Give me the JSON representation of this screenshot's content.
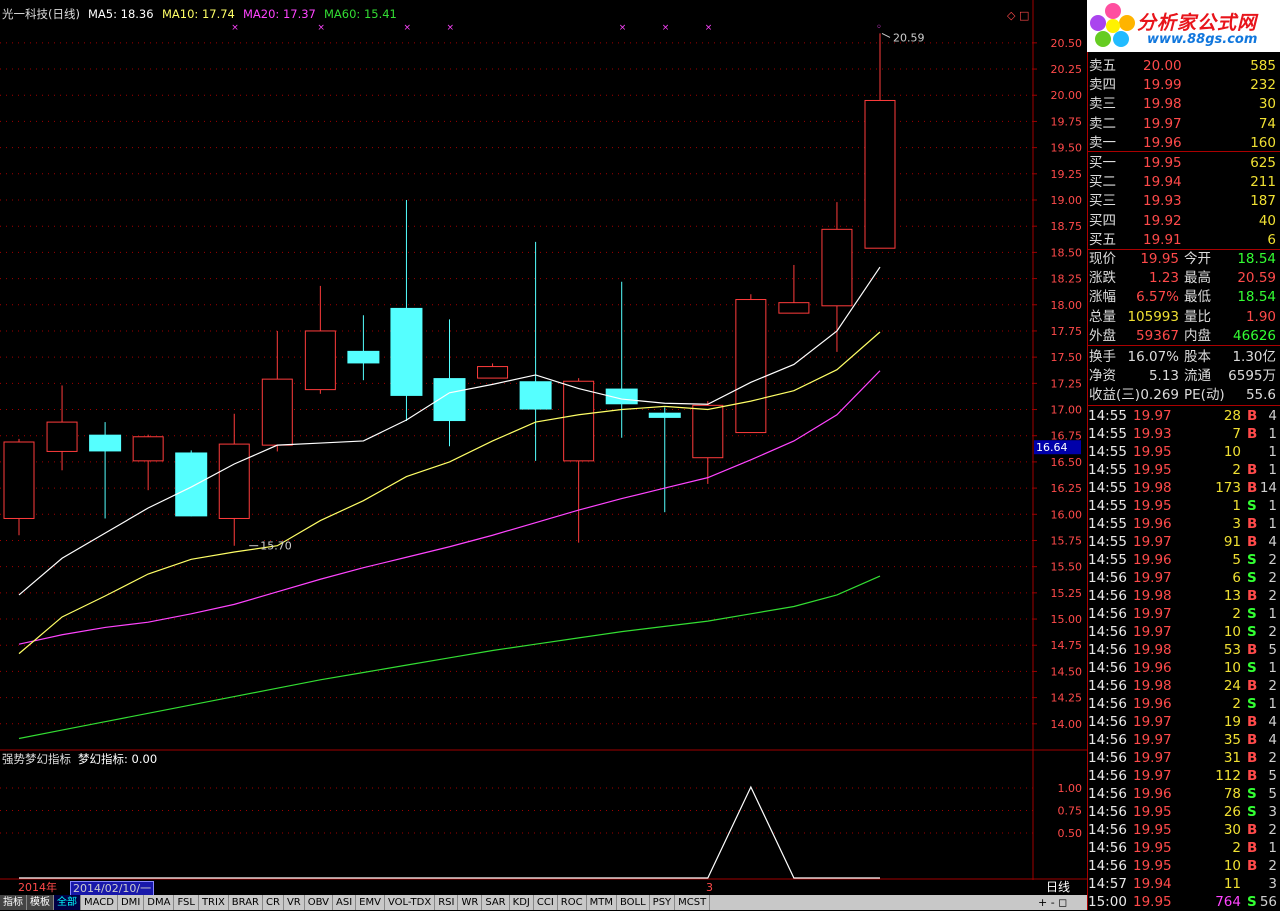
{
  "header": {
    "title": "光一科技(日线)",
    "ma5": "MA5: 18.36",
    "ma10": "MA10: 17.74",
    "ma20": "MA20: 17.37",
    "ma60": "MA60: 15.41"
  },
  "indicator": {
    "title": "强势梦幻指标",
    "value_label": "梦幻指标: 0.00",
    "axis_labels": [
      "1.00",
      "0.75",
      "0.50"
    ]
  },
  "price_axis": [
    "20.50",
    "20.25",
    "20.00",
    "19.75",
    "19.50",
    "19.25",
    "19.00",
    "18.75",
    "18.50",
    "18.25",
    "18.00",
    "17.75",
    "17.50",
    "17.25",
    "17.00",
    "16.75",
    "16.50",
    "16.25",
    "16.00",
    "15.75",
    "15.50",
    "15.25",
    "15.00",
    "14.75",
    "14.50",
    "14.25",
    "14.00"
  ],
  "price_marker": "16.64",
  "annotations": {
    "high": "20.59",
    "low": "15.70"
  },
  "chart_data": {
    "type": "candlestick",
    "ylim": [
      13.75,
      20.68
    ],
    "candles": [
      {
        "o": 15.96,
        "c": 16.69,
        "h": 16.72,
        "l": 15.8
      },
      {
        "o": 16.6,
        "c": 16.88,
        "h": 17.23,
        "l": 16.42
      },
      {
        "o": 16.76,
        "c": 16.6,
        "h": 16.88,
        "l": 15.96
      },
      {
        "o": 16.51,
        "c": 16.74,
        "h": 16.76,
        "l": 16.23
      },
      {
        "o": 16.59,
        "c": 15.98,
        "h": 16.61,
        "l": 15.98
      },
      {
        "o": 15.96,
        "c": 16.67,
        "h": 16.96,
        "l": 15.7
      },
      {
        "o": 16.66,
        "c": 17.29,
        "h": 17.75,
        "l": 16.6
      },
      {
        "o": 17.19,
        "c": 17.75,
        "h": 18.18,
        "l": 17.15
      },
      {
        "o": 17.56,
        "c": 17.44,
        "h": 17.9,
        "l": 17.28
      },
      {
        "o": 17.97,
        "c": 17.13,
        "h": 19.0,
        "l": 16.89
      },
      {
        "o": 17.3,
        "c": 16.89,
        "h": 17.86,
        "l": 16.65
      },
      {
        "o": 17.3,
        "c": 17.41,
        "h": 17.44,
        "l": 17.3
      },
      {
        "o": 17.27,
        "c": 17.0,
        "h": 18.6,
        "l": 16.51
      },
      {
        "o": 16.51,
        "c": 17.27,
        "h": 17.3,
        "l": 15.73
      },
      {
        "o": 17.2,
        "c": 17.05,
        "h": 18.22,
        "l": 16.73
      },
      {
        "o": 16.97,
        "c": 16.92,
        "h": 17.02,
        "l": 16.02
      },
      {
        "o": 16.54,
        "c": 17.04,
        "h": 17.08,
        "l": 16.29
      },
      {
        "o": 16.78,
        "c": 18.05,
        "h": 18.1,
        "l": 16.78
      },
      {
        "o": 17.92,
        "c": 18.02,
        "h": 18.38,
        "l": 17.92
      },
      {
        "o": 17.99,
        "c": 18.72,
        "h": 18.98,
        "l": 17.55
      },
      {
        "o": 18.54,
        "c": 19.95,
        "h": 20.59,
        "l": 18.54
      }
    ],
    "ma5": [
      15.23,
      15.58,
      15.82,
      16.06,
      16.26,
      16.48,
      16.66,
      16.68,
      16.7,
      16.9,
      17.16,
      17.24,
      17.33,
      17.2,
      17.1,
      17.06,
      17.05,
      17.26,
      17.43,
      17.75,
      18.36
    ],
    "ma10": [
      14.67,
      15.02,
      15.22,
      15.43,
      15.57,
      15.64,
      15.7,
      15.94,
      16.13,
      16.36,
      16.5,
      16.7,
      16.88,
      16.95,
      17.0,
      17.03,
      17.0,
      17.08,
      17.18,
      17.38,
      17.74
    ],
    "ma20": [
      14.76,
      14.85,
      14.92,
      14.97,
      15.05,
      15.14,
      15.26,
      15.38,
      15.49,
      15.59,
      15.69,
      15.8,
      15.92,
      16.04,
      16.15,
      16.25,
      16.35,
      16.52,
      16.7,
      16.95,
      17.37
    ],
    "ma60": [
      13.86,
      13.94,
      14.02,
      14.1,
      14.18,
      14.26,
      14.34,
      14.42,
      14.49,
      14.56,
      14.63,
      14.7,
      14.76,
      14.82,
      14.88,
      14.93,
      14.98,
      15.05,
      15.12,
      15.23,
      15.41
    ],
    "indicator": [
      0,
      0,
      0,
      0,
      0,
      0,
      0,
      0,
      0,
      0,
      0,
      0,
      0,
      0,
      0,
      0,
      0,
      1,
      0,
      0,
      0
    ],
    "indicator_ylim": [
      0,
      1.2
    ]
  },
  "orderbook": {
    "asks": [
      {
        "label": "卖五",
        "price": "20.00",
        "vol": "585"
      },
      {
        "label": "卖四",
        "price": "19.99",
        "vol": "232"
      },
      {
        "label": "卖三",
        "price": "19.98",
        "vol": "30"
      },
      {
        "label": "卖二",
        "price": "19.97",
        "vol": "74"
      },
      {
        "label": "卖一",
        "price": "19.96",
        "vol": "160"
      }
    ],
    "bids": [
      {
        "label": "买一",
        "price": "19.95",
        "vol": "625"
      },
      {
        "label": "买二",
        "price": "19.94",
        "vol": "211"
      },
      {
        "label": "买三",
        "price": "19.93",
        "vol": "187"
      },
      {
        "label": "买四",
        "price": "19.92",
        "vol": "40"
      },
      {
        "label": "买五",
        "price": "19.91",
        "vol": "6"
      }
    ]
  },
  "stats": [
    {
      "l1": "现价",
      "v1": "19.95",
      "c1": "#ff4a4a",
      "l2": "今开",
      "v2": "18.54",
      "c2": "#33ff33"
    },
    {
      "l1": "涨跌",
      "v1": "1.23",
      "c1": "#ff4a4a",
      "l2": "最高",
      "v2": "20.59",
      "c2": "#ff4a4a"
    },
    {
      "l1": "涨幅",
      "v1": "6.57%",
      "c1": "#ff4a4a",
      "l2": "最低",
      "v2": "18.54",
      "c2": "#33ff33"
    },
    {
      "l1": "总量",
      "v1": "105993",
      "c1": "#f0e033",
      "l2": "量比",
      "v2": "1.90",
      "c2": "#ff4a4a"
    },
    {
      "l1": "外盘",
      "v1": "59367",
      "c1": "#ff4a4a",
      "l2": "内盘",
      "v2": "46626",
      "c2": "#33ff33"
    },
    {
      "l1": "换手",
      "v1": "16.07%",
      "c1": "#dcdcdc",
      "l2": "股本",
      "v2": "1.30亿",
      "c2": "#dcdcdc"
    },
    {
      "l1": "净资",
      "v1": "5.13",
      "c1": "#dcdcdc",
      "l2": "流通",
      "v2": "6595万",
      "c2": "#dcdcdc"
    },
    {
      "l1": "收益(三)",
      "v1": "0.269",
      "c1": "#dcdcdc",
      "l2": "PE(动)",
      "v2": "55.6",
      "c2": "#dcdcdc"
    }
  ],
  "ticks": [
    {
      "t": "14:55",
      "p": "19.97",
      "v": "28",
      "d": "B",
      "n": "4"
    },
    {
      "t": "14:55",
      "p": "19.93",
      "v": "7",
      "d": "B",
      "n": "1"
    },
    {
      "t": "14:55",
      "p": "19.95",
      "v": "10",
      "d": "",
      "n": "1"
    },
    {
      "t": "14:55",
      "p": "19.95",
      "v": "2",
      "d": "B",
      "n": "1"
    },
    {
      "t": "14:55",
      "p": "19.98",
      "v": "173",
      "d": "B",
      "n": "14"
    },
    {
      "t": "14:55",
      "p": "19.95",
      "v": "1",
      "d": "S",
      "n": "1"
    },
    {
      "t": "14:55",
      "p": "19.96",
      "v": "3",
      "d": "B",
      "n": "1"
    },
    {
      "t": "14:55",
      "p": "19.97",
      "v": "91",
      "d": "B",
      "n": "4"
    },
    {
      "t": "14:55",
      "p": "19.96",
      "v": "5",
      "d": "S",
      "n": "2"
    },
    {
      "t": "14:56",
      "p": "19.97",
      "v": "6",
      "d": "S",
      "n": "2"
    },
    {
      "t": "14:56",
      "p": "19.98",
      "v": "13",
      "d": "B",
      "n": "2"
    },
    {
      "t": "14:56",
      "p": "19.97",
      "v": "2",
      "d": "S",
      "n": "1"
    },
    {
      "t": "14:56",
      "p": "19.97",
      "v": "10",
      "d": "S",
      "n": "2"
    },
    {
      "t": "14:56",
      "p": "19.98",
      "v": "53",
      "d": "B",
      "n": "5"
    },
    {
      "t": "14:56",
      "p": "19.96",
      "v": "10",
      "d": "S",
      "n": "1"
    },
    {
      "t": "14:56",
      "p": "19.98",
      "v": "24",
      "d": "B",
      "n": "2"
    },
    {
      "t": "14:56",
      "p": "19.96",
      "v": "2",
      "d": "S",
      "n": "1"
    },
    {
      "t": "14:56",
      "p": "19.97",
      "v": "19",
      "d": "B",
      "n": "4"
    },
    {
      "t": "14:56",
      "p": "19.97",
      "v": "35",
      "d": "B",
      "n": "4"
    },
    {
      "t": "14:56",
      "p": "19.97",
      "v": "31",
      "d": "B",
      "n": "2"
    },
    {
      "t": "14:56",
      "p": "19.97",
      "v": "112",
      "d": "B",
      "n": "5"
    },
    {
      "t": "14:56",
      "p": "19.96",
      "v": "78",
      "d": "S",
      "n": "5"
    },
    {
      "t": "14:56",
      "p": "19.95",
      "v": "26",
      "d": "S",
      "n": "3"
    },
    {
      "t": "14:56",
      "p": "19.95",
      "v": "30",
      "d": "B",
      "n": "2"
    },
    {
      "t": "14:56",
      "p": "19.95",
      "v": "2",
      "d": "B",
      "n": "1"
    },
    {
      "t": "14:56",
      "p": "19.95",
      "v": "10",
      "d": "B",
      "n": "2"
    },
    {
      "t": "14:57",
      "p": "19.94",
      "v": "11",
      "d": "",
      "n": "3"
    },
    {
      "t": "15:00",
      "p": "19.95",
      "v": "764",
      "d": "S",
      "n": "56"
    }
  ],
  "dates": {
    "year": "2014年",
    "current": "2014/02/10/一",
    "marker": "3"
  },
  "period": "日线",
  "zoom": "+ - ◻",
  "tabs": [
    "指标",
    "模板",
    "全部",
    "MACD",
    "DMI",
    "DMA",
    "FSL",
    "TRIX",
    "BRAR",
    "CR",
    "VR",
    "OBV",
    "ASI",
    "EMV",
    "VOL-TDX",
    "RSI",
    "WR",
    "SAR",
    "KDJ",
    "CCI",
    "ROC",
    "MTM",
    "BOLL",
    "PSY",
    "MCST"
  ],
  "logo": {
    "text": "分析家公式网",
    "url": "www.88gs.com"
  },
  "colors": {
    "up": "#ff3c3c",
    "down": "#55ffff",
    "ma5": "#ffffff",
    "ma10": "#ffff66",
    "ma20": "#ff44ff",
    "ma60": "#33dd33",
    "grid": "#a00000"
  }
}
